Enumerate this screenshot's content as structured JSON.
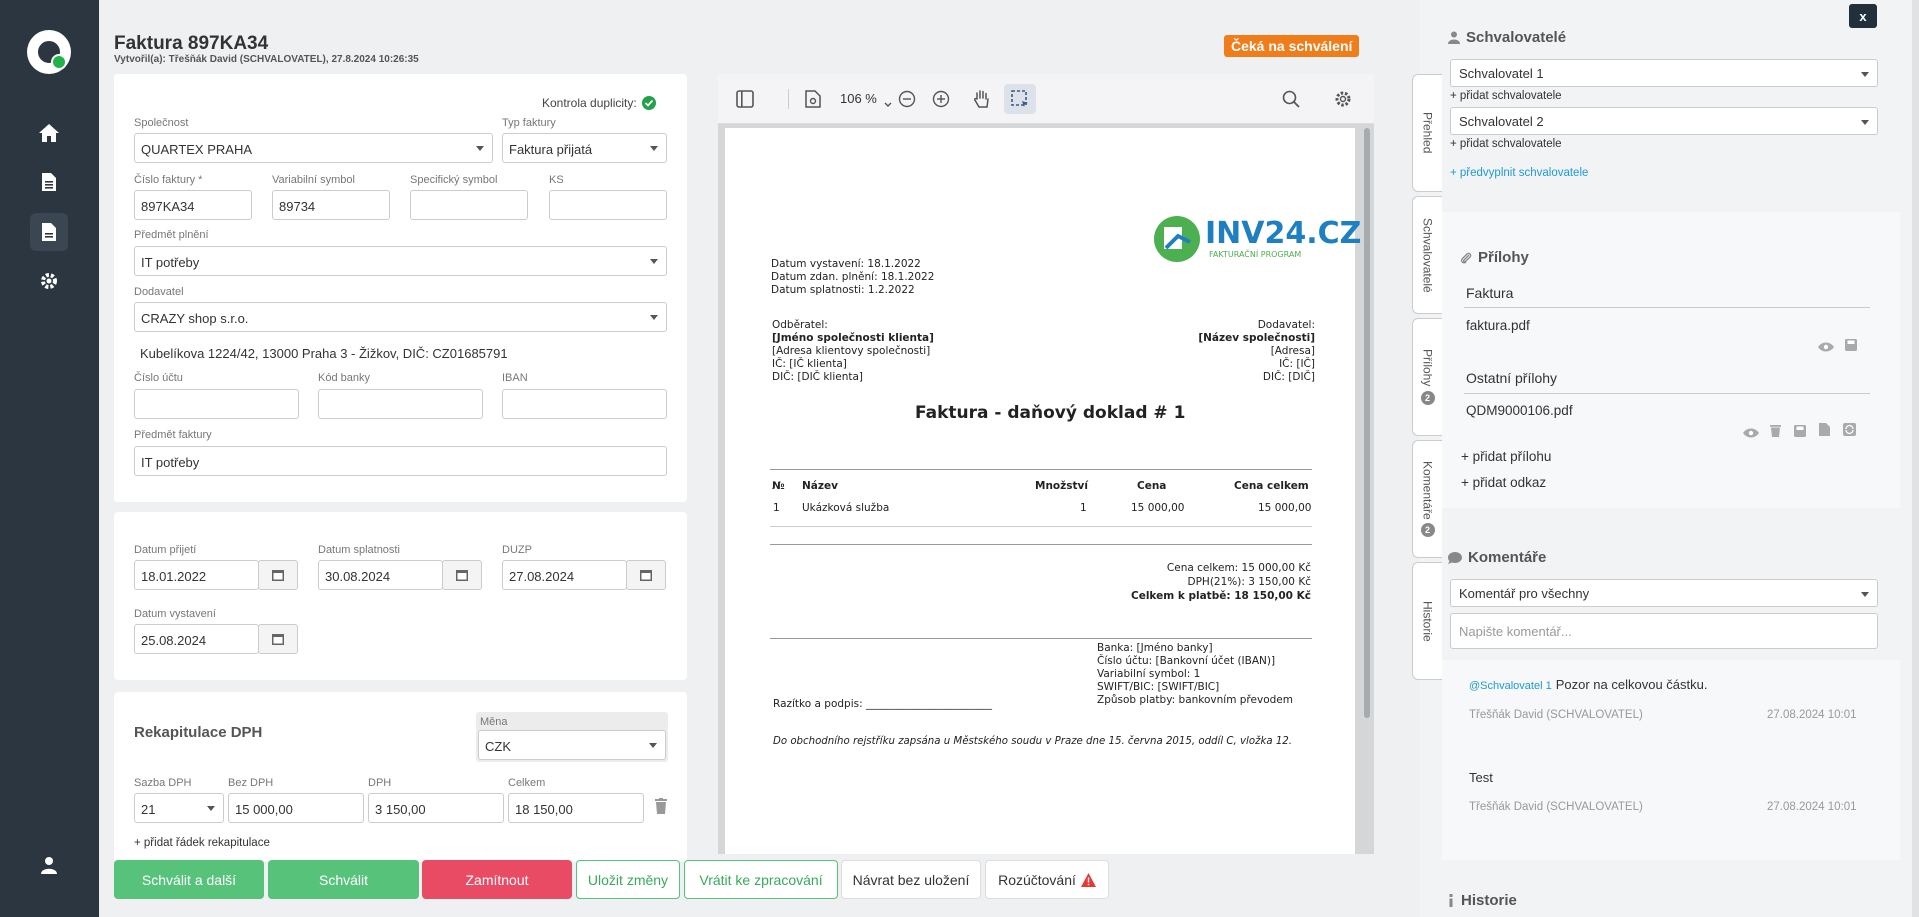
{
  "header": {
    "title": "Faktura 897KA34",
    "created": "Vytvořil(a): Třešňák David (SCHVALOVATEL), 27.8.2024 10:26:35",
    "status": "Čeká na schválení"
  },
  "form": {
    "duplicity_label": "Kontrola duplicity:",
    "spolecnost": {
      "label": "Společnost",
      "value": "QUARTEX PRAHA"
    },
    "typ": {
      "label": "Typ faktury",
      "value": "Faktura přijatá"
    },
    "cislo": {
      "label": "Číslo faktury *",
      "value": "897KA34"
    },
    "vs": {
      "label": "Variabilní symbol",
      "value": "89734"
    },
    "ss": {
      "label": "Specifický symbol",
      "value": ""
    },
    "ks": {
      "label": "KS",
      "value": ""
    },
    "predmet_plneni": {
      "label": "Předmět plnění",
      "value": "IT potřeby"
    },
    "dodavatel": {
      "label": "Dodavatel",
      "value": "CRAZY shop s.r.o."
    },
    "dodavatel_adresa": "Kubelíkova 1224/42, 13000 Praha 3 - Žižkov, DIČ: CZ01685791",
    "cislo_uctu": {
      "label": "Číslo účtu",
      "value": ""
    },
    "kod_banky": {
      "label": "Kód banky",
      "value": ""
    },
    "iban": {
      "label": "IBAN",
      "value": ""
    },
    "predmet_faktury": {
      "label": "Předmět faktury",
      "value": "IT potřeby"
    }
  },
  "dates": {
    "prijeti": {
      "label": "Datum přijetí",
      "value": "18.01.2022"
    },
    "splatnosti": {
      "label": "Datum splatnosti",
      "value": "30.08.2024"
    },
    "duzp": {
      "label": "DUZP",
      "value": "27.08.2024"
    },
    "vystaveni": {
      "label": "Datum vystavení",
      "value": "25.08.2024"
    }
  },
  "vat": {
    "title": "Rekapitulace DPH",
    "mena_label": "Měna",
    "mena": "CZK",
    "col_sazba": "Sazba DPH",
    "col_bez": "Bez DPH",
    "col_dph": "DPH",
    "col_celkem": "Celkem",
    "row": {
      "sazba": "21",
      "bez": "15 000,00",
      "dph": "3 150,00",
      "celkem": "18 150,00"
    },
    "add": "+ přidat řádek rekapitulace"
  },
  "buttons": {
    "approve_next": "Schválit a další",
    "approve": "Schválit",
    "reject": "Zamítnout",
    "save": "Uložit změny",
    "return": "Vrátit ke zpracování",
    "back": "Návrat bez uložení",
    "account": "Rozúčtování"
  },
  "pdf": {
    "zoom": "106 %",
    "logo_text": "INV24.CZ",
    "logo_sub": "FAKTURAČNÍ PROGRAM",
    "dates": [
      "Datum vystavení: 18.1.2022",
      "Datum zdan. plnění: 18.1.2022",
      "Datum splatnosti: 1.2.2022"
    ],
    "odberatel": [
      "Odběratel:",
      "[Jméno společnosti klienta]",
      "[Adresa klientovy společnosti]",
      "IČ: [IČ klienta]",
      "DIČ: [DIČ klienta]"
    ],
    "dodavatel": [
      "Dodavatel:",
      "[Název společnosti]",
      "[Adresa]",
      "IČ: [IČ]",
      "DIČ: [DIČ]"
    ],
    "title": "Faktura - daňový doklad # 1",
    "cols": [
      "№",
      "Název",
      "Množství",
      "Cena",
      "Cena celkem"
    ],
    "row": [
      "1",
      "Ukázková služba",
      "1",
      "15 000,00",
      "15 000,00"
    ],
    "sum1": "Cena celkem: 15 000,00 Kč",
    "sum2": "DPH(21%): 3 150,00 Kč",
    "sum3": "Celkem k platbě: 18 150,00 Kč",
    "bank": [
      "Banka: [Jméno banky]",
      "Číslo účtu: [Bankovní účet (IBAN)]",
      "Variabilní symbol: 1",
      "SWIFT/BIC: [SWIFT/BIC]",
      "Způsob platby: bankovním převodem"
    ],
    "stamp": "Razítko a podpis: ________________________",
    "footer": "Do obchodního rejstříku zapsána u Městského soudu v Praze dne 15. června 2015, oddíl C, vložka 12."
  },
  "tabs": [
    "Přehled",
    "Schvalovatelé",
    "Přílohy",
    "Komentáře",
    "Historie"
  ],
  "tab_badges": {
    "prilohy": "2",
    "komentare": "2"
  },
  "right": {
    "close": "x",
    "approvers_title": "Schvalovatelé",
    "approver1": "Schvalovatel 1",
    "approver2": "Schvalovatel 2",
    "add_approver": "+ přidat schvalovatele",
    "prefill": "+ předvyplnit schvalovatele",
    "attachments_title": "Přílohy",
    "faktura_head": "Faktura",
    "faktura_file": "faktura.pdf",
    "other_head": "Ostatní přílohy",
    "other_file": "QDM9000106.pdf",
    "add_attachment": "+ přidat přílohu",
    "add_link": "+ přidat odkaz",
    "comments_title": "Komentáře",
    "comment_scope": "Komentář pro všechny",
    "comment_placeholder": "Napište komentář...",
    "c1_mention": "@Schvalovatel 1",
    "c1_text": "Pozor na celkovou částku.",
    "c1_author": "Třešňák David (SCHVALOVATEL)",
    "c1_time": "27.08.2024 10:01",
    "c2_text": "Test",
    "c2_author": "Třešňák David (SCHVALOVATEL)",
    "c2_time": "27.08.2024 10:01",
    "history_title": "Historie"
  },
  "colors": {
    "accent": "#56c27a",
    "reject": "#e94b64",
    "status": "#f07d1a",
    "sidebar": "#2b3640",
    "link": "#1e9ad6"
  }
}
